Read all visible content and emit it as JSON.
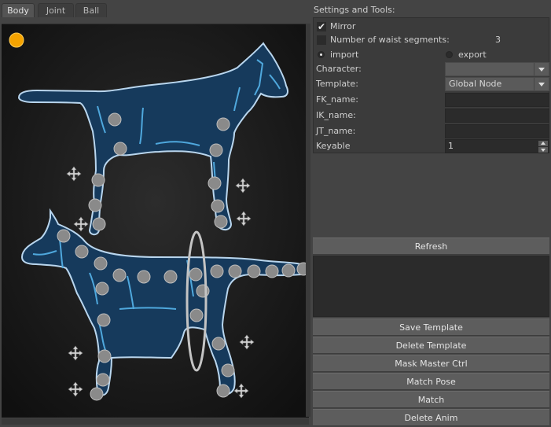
{
  "tabs": [
    {
      "label": "Body",
      "active": true
    },
    {
      "label": "Joint",
      "active": false
    },
    {
      "label": "Ball",
      "active": false
    }
  ],
  "colors": {
    "accent_dot": "#f5a300",
    "body_fill": "#163a5c",
    "body_outline": "#b9d6ee",
    "muscle": "#4fa8dd",
    "control": "#8a8a8a"
  },
  "canvas": {
    "icons": [
      "control-dot-icon",
      "move-icon",
      "ring-icon",
      "horse-icon"
    ]
  },
  "settings": {
    "title": "Settings and Tools:",
    "mirror": {
      "label": "Mirror",
      "checked": true
    },
    "waist": {
      "label": "Number of waist segments:",
      "checked": false,
      "value": "3"
    },
    "import_label": "import",
    "export_label": "export",
    "selected_mode": "import",
    "character": {
      "label": "Character:",
      "value": ""
    },
    "template": {
      "label": "Template:",
      "value": "Global Node"
    },
    "fk_name": {
      "label": "FK_name:",
      "value": ""
    },
    "ik_name": {
      "label": "IK_name:",
      "value": ""
    },
    "jt_name": {
      "label": "JT_name:",
      "value": ""
    },
    "keyable": {
      "label": "Keyable",
      "value": "1"
    }
  },
  "buttons": {
    "refresh": "Refresh",
    "save_template": "Save Template",
    "delete_template": "Delete Template",
    "mask_master_ctrl": "Mask Master Ctrl",
    "match_pose": "Match Pose",
    "match": "Match",
    "delete_anim": "Delete Anim"
  }
}
